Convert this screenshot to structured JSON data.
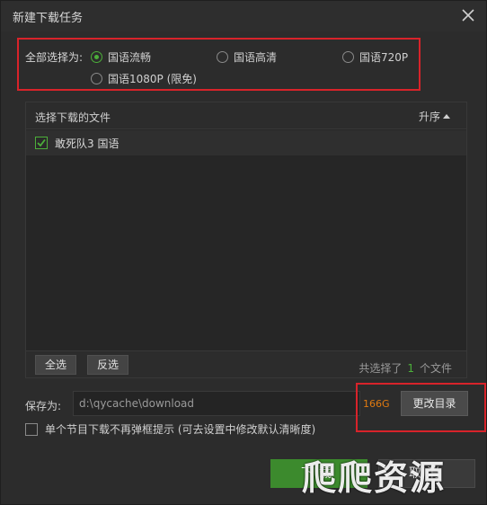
{
  "window": {
    "title": "新建下载任务"
  },
  "quality": {
    "label": "全部选择为:",
    "options": [
      {
        "label": "国语流畅",
        "checked": true
      },
      {
        "label": "国语高清",
        "checked": false
      },
      {
        "label": "国语720P",
        "checked": false
      },
      {
        "label": "国语1080P (限免)",
        "checked": false
      }
    ]
  },
  "files": {
    "header": "选择下载的文件",
    "sort_label": "升序",
    "items": [
      {
        "name": "敢死队3 国语",
        "checked": true
      }
    ]
  },
  "footer": {
    "select_all": "全选",
    "invert": "反选",
    "count_prefix": "共选择了",
    "count": "1",
    "count_suffix": "个文件"
  },
  "save": {
    "label": "保存为:",
    "path": "d:\\qycache\\download",
    "free_space": "166G",
    "change_dir": "更改目录"
  },
  "no_prompt": {
    "label": "单个节目下载不再弹框提示 (可去设置中修改默认清晰度)",
    "checked": false
  },
  "actions": {
    "download": "下载",
    "cancel": "取消"
  },
  "watermark": "爬爬资源",
  "colors": {
    "accent_green": "#4caf3a",
    "highlight_red": "#d8232a",
    "space_orange": "#e07a10"
  }
}
